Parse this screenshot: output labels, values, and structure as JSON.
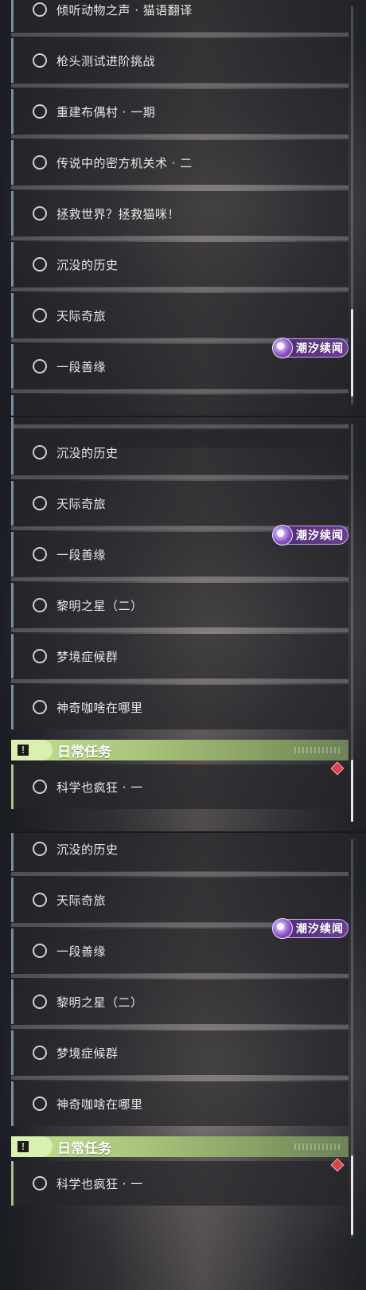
{
  "panel1": {
    "quests": [
      "倾听动物之声 · 猫语翻译",
      "枪头测试进阶挑战",
      "重建布偶村 · 一期",
      "传说中的密方机关术 · 二",
      "拯救世界？拯救猫咪！",
      "沉没的历史",
      "天际奇旅",
      "一段善缘"
    ],
    "badge": "潮汐续闻"
  },
  "panel2": {
    "quests": [
      "沉没的历史",
      "天际奇旅",
      "一段善缘",
      "黎明之星（二）",
      "梦境症候群",
      "神奇咖啥在哪里"
    ],
    "badge": "潮汐续闻",
    "section_title": "日常任务",
    "section_icon": "!",
    "daily_quest": "科学也疯狂 · 一"
  },
  "panel3": {
    "quests": [
      "沉没的历史",
      "天际奇旅",
      "一段善缘",
      "黎明之星（二）",
      "梦境症候群",
      "神奇咖啥在哪里"
    ],
    "badge": "潮汐续闻",
    "section_title": "日常任务",
    "section_icon": "!",
    "daily_quest": "科学也疯狂 · 一"
  },
  "icons": {
    "quest_marker": "radio-circle-icon",
    "badge": "tidal-sequel-icon",
    "section": "exclamation-icon",
    "tracked": "red-diamond-icon"
  },
  "colors": {
    "row_bg": "#26262a",
    "row_border": "#7a8ea0",
    "section_green": "#a8c47a",
    "badge_purple": "#6a3f95",
    "diamond_red": "#d9434c"
  }
}
